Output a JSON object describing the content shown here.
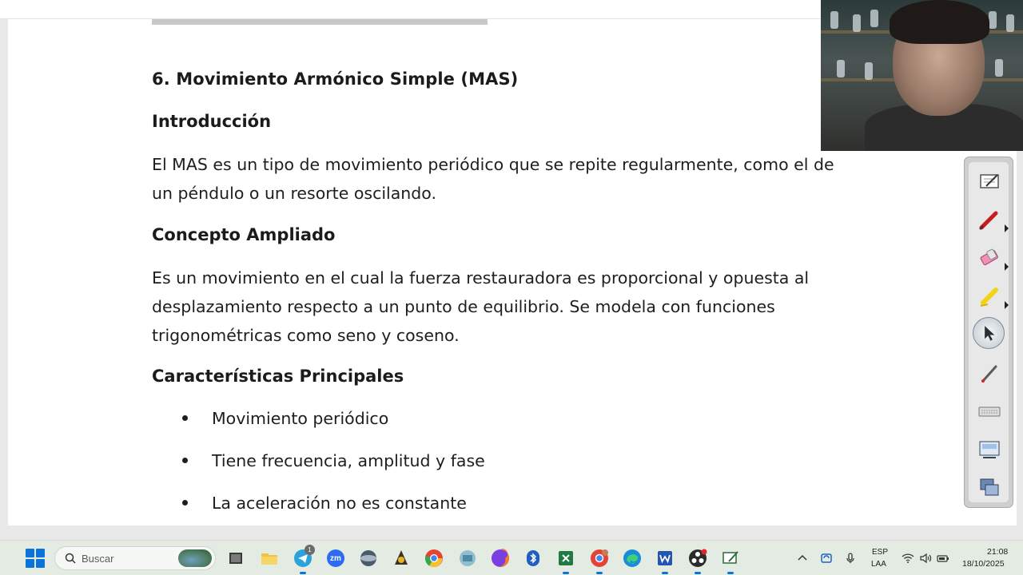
{
  "document": {
    "heading": "6. Movimiento Armónico Simple (MAS)",
    "sections": {
      "intro_title": "Introducción",
      "intro_line1": "El MAS es un tipo de movimiento periódico que se repite regularmente, como el de",
      "intro_line2": "un péndulo o un resorte oscilando.",
      "concept_title": "Concepto Ampliado",
      "concept_line1": "Es un movimiento en el cual la fuerza restauradora es proporcional y opuesta al",
      "concept_line2": "desplazamiento respecto a un punto de equilibrio. Se modela con funciones",
      "concept_line3": "trigonométricas como seno y coseno.",
      "features_title": "Características Principales",
      "features": [
        "Movimiento periódico",
        "Tiene frecuencia, amplitud y fase"
      ],
      "feature3": "La aceleración no es constante"
    }
  },
  "ink_toolbar": {
    "tools": [
      "notepad-icon",
      "red-pen-icon",
      "eraser-icon",
      "highlighter-icon",
      "cursor-icon",
      "laser-pointer-icon",
      "keyboard-icon",
      "screen-capture-icon",
      "display-icon"
    ]
  },
  "taskbar": {
    "search_placeholder": "Buscar",
    "apps": [
      "file-explorer-icon",
      "folder-icon",
      "telegram-icon",
      "zoom-icon",
      "app-icon",
      "app-icon-2",
      "chrome-icon",
      "app-icon-3",
      "firefox-icon",
      "bluetooth-icon",
      "excel-icon",
      "chrome-profile-icon",
      "edge-icon",
      "word-icon",
      "obs-icon",
      "annotate-icon"
    ],
    "telegram_badge": "1",
    "zoom_label": "zm",
    "tray": {
      "lang_top": "ESP",
      "lang_bottom": "LAA",
      "time": "21:08",
      "date": "18/10/2025"
    }
  },
  "colors": {
    "accent": "#0a74d9",
    "taskbar_bg": "#e4ebe2",
    "text": "#1b1b1b"
  }
}
